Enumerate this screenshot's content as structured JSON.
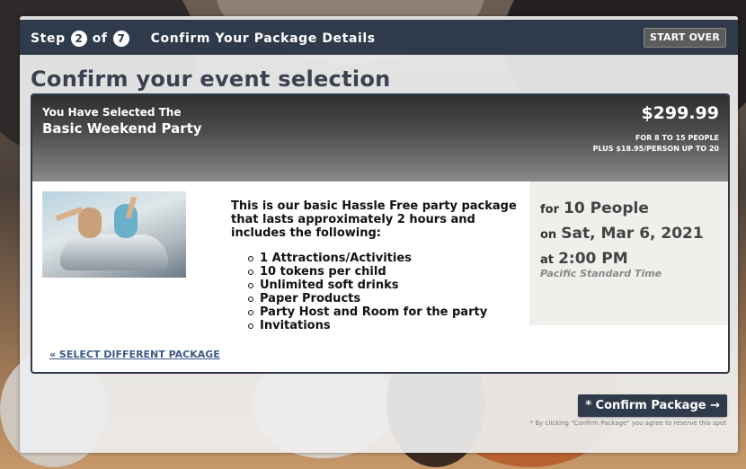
{
  "header": {
    "step_word": "Step",
    "step_current": "2",
    "step_of": "of",
    "step_total": "7",
    "title": "Confirm Your Package Details",
    "start_over": "START OVER"
  },
  "page_heading": "Confirm your event selection",
  "package": {
    "selected_label": "You Have Selected The",
    "name": "Basic Weekend Party",
    "price": "$299.99",
    "people_line1": "FOR 8 TO 15 PEOPLE",
    "people_line2": "PLUS $18.95/PERSON UP TO 20",
    "description": "This is our basic Hassle Free party package that lasts approximately 2 hours and includes the following:",
    "features": [
      "1 Attractions/Activities",
      "10 tokens per child",
      "Unlimited soft drinks",
      "Paper Products",
      "Party Host and Room for the party",
      "Invitations"
    ]
  },
  "booking": {
    "for_label": "for",
    "people": "10 People",
    "on_label": "on",
    "date": "Sat, Mar 6, 2021",
    "at_label": "at",
    "time": "2:00 PM",
    "timezone": "Pacific Standard Time"
  },
  "links": {
    "select_different": "« SELECT DIFFERENT PACKAGE"
  },
  "actions": {
    "confirm": "* Confirm Package →",
    "confirm_note": "* By clicking \"Confirm Package\" you agree to reserve this spot"
  }
}
